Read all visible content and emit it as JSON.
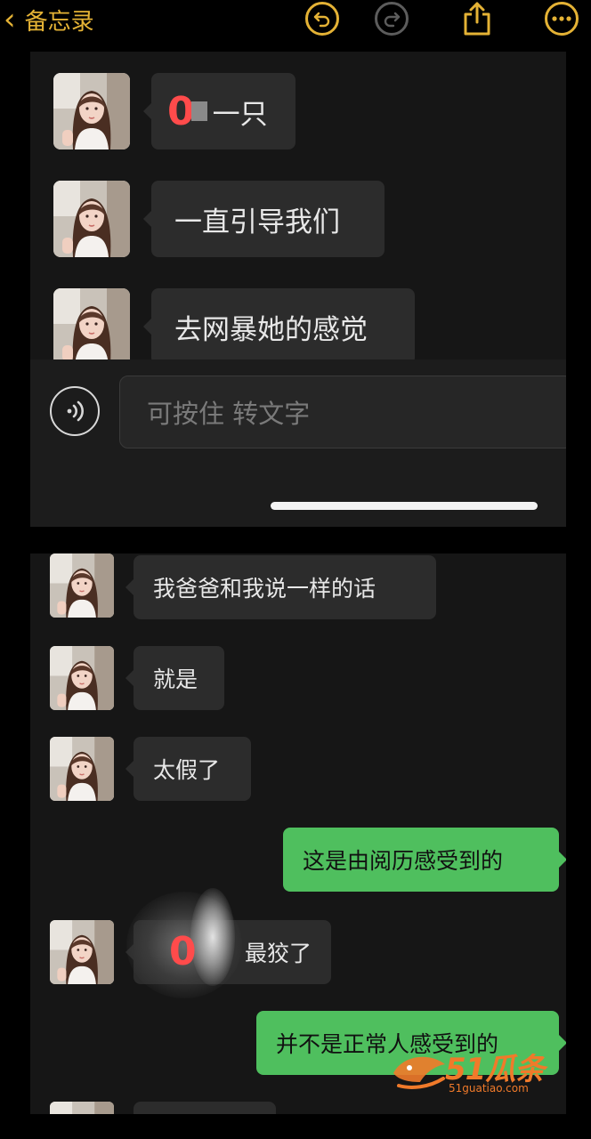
{
  "header": {
    "back_label": "备忘录",
    "icons": [
      "undo-icon",
      "redo-icon",
      "share-icon",
      "more-icon"
    ],
    "accent_color": "#e4b235"
  },
  "panel1": {
    "messages": [
      {
        "side": "left",
        "text": "一只",
        "censor_digit": "0"
      },
      {
        "side": "left",
        "text": "一直引导我们"
      },
      {
        "side": "left",
        "text": "去网暴她的感觉"
      }
    ],
    "input_placeholder": "可按住 转文字"
  },
  "panel2": {
    "messages": [
      {
        "side": "left",
        "text": "我爸爸和我说一样的话"
      },
      {
        "side": "left",
        "text": "就是"
      },
      {
        "side": "left",
        "text": "太假了"
      },
      {
        "side": "right",
        "text": "这是由阅历感受到的"
      },
      {
        "side": "left",
        "text": "最狡了",
        "censor_digit": "0"
      },
      {
        "side": "right",
        "text": "并不是正常人感受到的"
      }
    ]
  },
  "watermark": {
    "brand": "51瓜条",
    "url": "51guatiao.com",
    "color": "#f07a2a"
  }
}
